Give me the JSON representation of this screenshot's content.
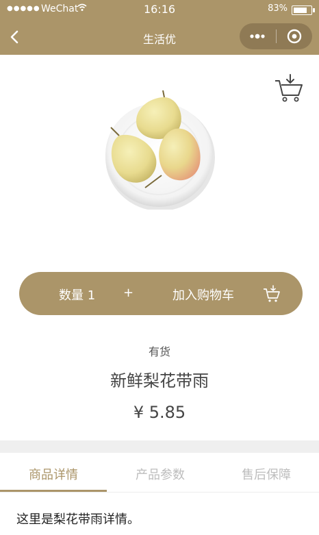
{
  "status_bar": {
    "signal": "●●●●●",
    "carrier": "WeChat",
    "time": "16:16",
    "battery": "83%",
    "battery_level": 0.83
  },
  "nav": {
    "title": "生活优",
    "back_icon": "chevron-left-icon",
    "more_icon": "more-dots-icon",
    "close_icon": "target-circle-icon"
  },
  "product": {
    "image_icon": "pears-on-plate-image",
    "stock": "有货",
    "name": "新鲜梨花带雨",
    "price": "¥ 5.85"
  },
  "actions": {
    "quantity": "数量 1",
    "plus": "+",
    "add_to_cart": "加入购物车",
    "cart_icon": "cart-download-icon"
  },
  "tabs": [
    {
      "label": "商品详情",
      "active": true
    },
    {
      "label": "产品参数",
      "active": false
    },
    {
      "label": "售后保障",
      "active": false
    }
  ],
  "detail_text": "这里是梨花带雨详情。",
  "colors": {
    "accent": "#ab9569",
    "tab_inactive": "#bdbdbd",
    "divider": "#efefef"
  }
}
